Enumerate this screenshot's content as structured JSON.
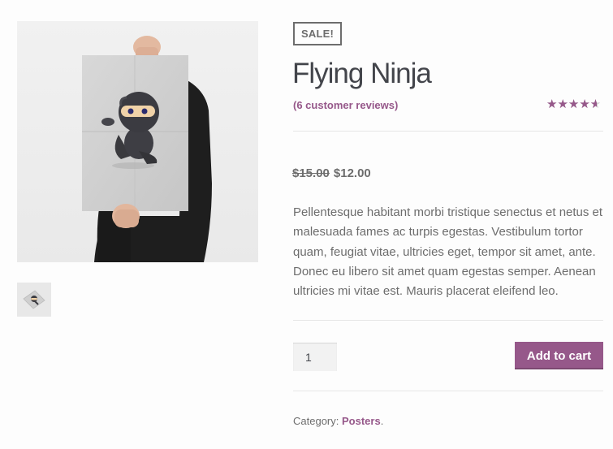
{
  "product": {
    "sale_badge": "Sale!",
    "title": "Flying Ninja",
    "reviews_link": "(6 customer reviews)",
    "rating": 4.33,
    "rating_max": 5,
    "price_old": "$15.00",
    "price_new": "$12.00",
    "description": "Pellentesque habitant morbi tristique senectus et netus et malesuada fames ac turpis egestas. Vestibulum tortor quam, feugiat vitae, ultricies eget, tempor sit amet, ante. Donec eu libero sit amet quam egestas semper. Aenean ultricies mi vitae est. Mauris placerat eleifend leo.",
    "quantity": "1",
    "add_to_cart_label": "Add to cart",
    "category_label": "Category:",
    "category_value": "Posters",
    "category_suffix": "."
  },
  "colors": {
    "accent": "#96588a",
    "text": "#6d6d6d",
    "heading": "#43454b",
    "star_empty": "#cfcfcf"
  },
  "icons": {
    "star": "star-icon"
  }
}
